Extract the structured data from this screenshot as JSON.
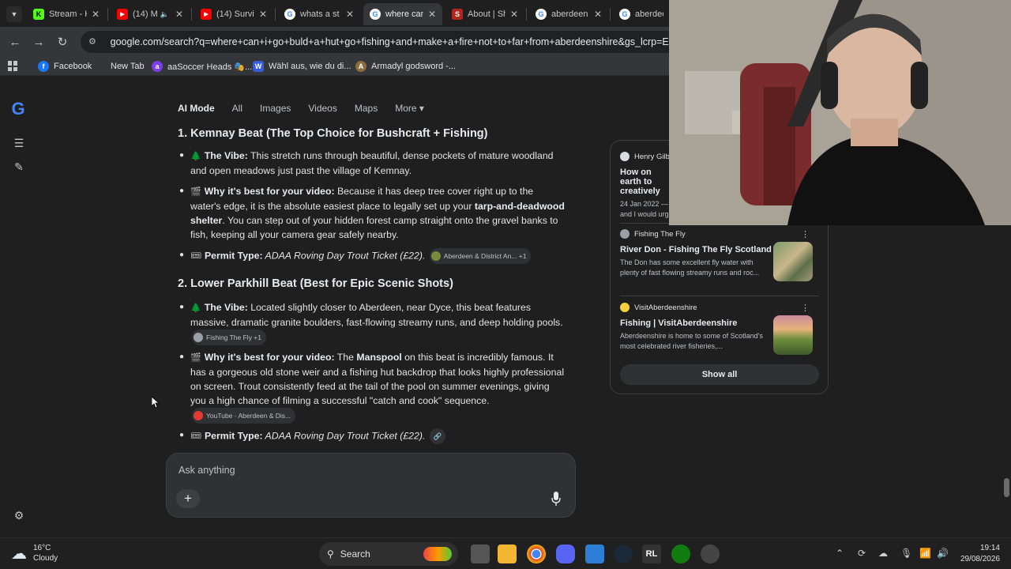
{
  "tabs": [
    {
      "title": "Stream - K",
      "color": "#53fc18",
      "glyph": "K"
    },
    {
      "title": "(14) M",
      "color": "#ff0000",
      "glyph": "▶"
    },
    {
      "title": "(14) Surviv",
      "color": "#ff0000",
      "glyph": "▶"
    },
    {
      "title": "whats a st",
      "color": "#4285f4",
      "glyph": "G"
    },
    {
      "title": "where can",
      "color": "#4285f4",
      "glyph": "G"
    },
    {
      "title": "About | Sh",
      "color": "#b3261e",
      "glyph": "S"
    },
    {
      "title": "aberdeen",
      "color": "#4285f4",
      "glyph": "G"
    },
    {
      "title": "aberdeen",
      "color": "#4285f4",
      "glyph": "G"
    }
  ],
  "toolbar": {
    "url": "google.com/search?q=where+can+i+go+buld+a+hut+go+fishing+and+make+a+fire+not+to+far+from+aberdeenshire&gs_lcrp=EgZjaH"
  },
  "bookmarks": [
    {
      "label": "Facebook",
      "color": "#1877f2",
      "glyph": "f"
    },
    {
      "label": "New Tab",
      "color": "",
      "glyph": ""
    },
    {
      "label": "aaSoccer Heads 🎭...",
      "color": "#7b3fe4",
      "glyph": "a"
    },
    {
      "label": "Wähl aus, wie du di...",
      "color": "#3a5bd9",
      "glyph": "W"
    },
    {
      "label": "Armadyl godsword -...",
      "color": "#8a6d3b",
      "glyph": "A"
    }
  ],
  "search_tabs": {
    "ai_mode": "AI Mode",
    "all": "All",
    "images": "Images",
    "videos": "Videos",
    "maps": "Maps",
    "more": "More ▾"
  },
  "answer": {
    "section1_title": "1. Kemnay Beat (The Top Choice for Bushcraft + Fishing)",
    "s1_vibe_label": "The Vibe:",
    "s1_vibe_text": " This stretch runs through beautiful, dense pockets of mature woodland and open meadows just past the village of Kemnay.",
    "s1_why_label": "Why it's best for your video:",
    "s1_why_text1": " Because it has deep tree cover right up to the water's edge, it is the absolute easiest place to legally set up your ",
    "s1_why_bold": "tarp-and-deadwood shelter",
    "s1_why_text2": ". You can step out of your hidden forest camp straight onto the gravel banks to fish, keeping all your camera gear safely nearby.",
    "s1_permit_label": "Permit Type:",
    "s1_permit_text": " ADAA Roving Day Trout Ticket (£22).",
    "s1_permit_chip": "Aberdeen & District An...",
    "s1_permit_chip_count": "+1",
    "section2_title": "2. Lower Parkhill Beat (Best for Epic Scenic Shots)",
    "s2_vibe_label": "The Vibe:",
    "s2_vibe_text": " Located slightly closer to Aberdeen, near Dyce, this beat features massive, dramatic granite boulders, fast-flowing streamy runs, and deep holding pools.",
    "s2_vibe_chip": "Fishing The Fly +1",
    "s2_why_label": "Why it's best for your video:",
    "s2_why_text1": " The ",
    "s2_why_bold": "Manspool",
    "s2_why_text2": " on this beat is incredibly famous. It has a gorgeous old stone weir and a fishing hut backdrop that looks highly professional on screen. Trout consistently feed at the tail of the pool on summer evenings, giving you a high chance of filming a successful \"catch and cook\" sequence.",
    "s2_why_chip": "YouTube · Aberdeen & Dis...",
    "s2_permit_label": "Permit Type:",
    "s2_permit_text": " ADAA Roving Day Trout Ticket (£22)."
  },
  "sources": {
    "items": [
      {
        "site": "Henry Gilbe",
        "title": "How on earth to creatively",
        "snippet": "24 Jan 2022 — and I would urg",
        "icon_color": "#dadce0"
      },
      {
        "site": "Fishing The Fly",
        "title": "River Don - Fishing The Fly Scotland",
        "snippet": "The Don has some excellent fly water with plenty of fast flowing streamy runs and roc...",
        "icon_color": "#9aa0a6"
      },
      {
        "site": "VisitAberdeenshire",
        "title": "Fishing | VisitAberdeenshire",
        "snippet": "Aberdeenshire is home to some of Scotland's most celebrated river fisheries,...",
        "icon_color": "#f4d03f"
      }
    ],
    "show_all": "Show all"
  },
  "ask": {
    "placeholder": "Ask anything",
    "plus": "+"
  },
  "taskbar": {
    "temperature": "16°C",
    "condition": "Cloudy",
    "search": "Search",
    "time": "19:14",
    "date": "29/08/2026"
  }
}
